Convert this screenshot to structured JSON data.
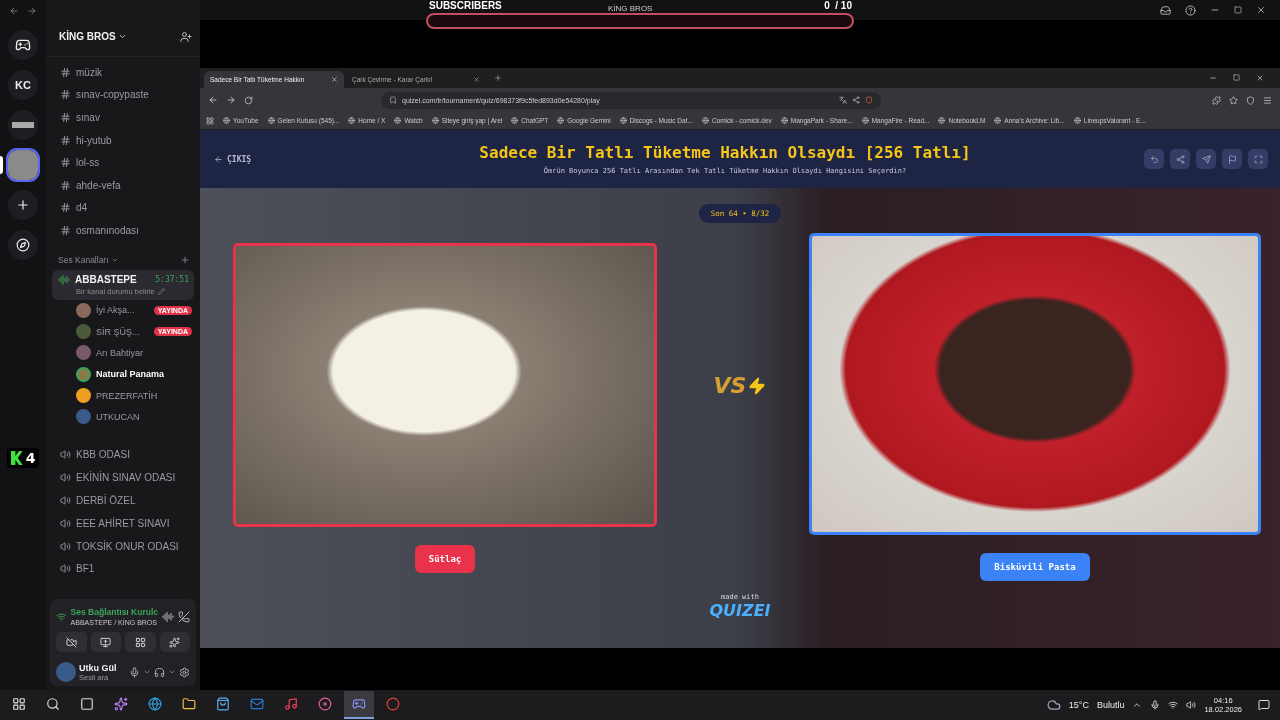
{
  "overlay": {
    "label": "SUBSCRIBERS",
    "server": "KİNG BROS",
    "count": "0",
    "goal": "/ 10",
    "level": 0
  },
  "servers": [
    {
      "kind": "logo"
    },
    {
      "kind": "initials",
      "label": "KC"
    },
    {
      "kind": "banner"
    },
    {
      "kind": "avatar",
      "selected": true
    },
    {
      "kind": "add"
    },
    {
      "kind": "explore"
    }
  ],
  "stream_badge": {
    "count": "4"
  },
  "server_name": "KİNG BROS",
  "text_channels": [
    "müzik",
    "sınav-copypaste",
    "sınav",
    "hi-yutub",
    "lol-ss",
    "ahde-vefa",
    "d4",
    "osmanınodası"
  ],
  "voice_header": "Ses Kanalları",
  "active_voice": {
    "name": "ABBASTEPE",
    "timer": "5:37:51",
    "status": "Bir kanal durumu belirle",
    "members": [
      {
        "name": "İyi Akşa...",
        "badge": "YAYINDA",
        "speaking": false,
        "color": "#8a6a5a"
      },
      {
        "name": "SİR ŞÜŞ...",
        "badge": "YAYINDA",
        "speaking": false,
        "color": "#4a5a3a"
      },
      {
        "name": "Arı Bahtiyar",
        "speaking": false,
        "color": "#7a5a6a"
      },
      {
        "name": "Natural Panama",
        "speaking": true,
        "color": "#8a7a4a"
      },
      {
        "name": "PREZERFATİH",
        "speaking": false,
        "color": "#f0a020"
      },
      {
        "name": "UTKUCAN",
        "speaking": false,
        "color": "#3a5a8a"
      }
    ]
  },
  "voice_channels": [
    "KBB ODASI",
    "EKİNİN SINAV ODASI",
    "DERBİ ÖZEL",
    "EEE AHİRET SINAVI",
    "TOKSİK ONUR ODASI",
    "BF1"
  ],
  "voice_connection": {
    "status": "Ses Bağlantısı Kurulc",
    "channel": "ABBASTEPE / KİNG BROS"
  },
  "user": {
    "name": "Utku Gül",
    "status": "Sesli ara"
  },
  "browser": {
    "tabs": [
      {
        "title": "Sadece Bir Tatlı Tüketme Hakkın",
        "selected": true
      },
      {
        "title": "Çark Çevirme - Karar Çarkı!",
        "selected": false
      }
    ],
    "url": "quizei.com/tr/tournament/quiz/698373f9c5fed893d0e54280/play",
    "bookmarks": [
      "YouTube",
      "Gelen Kutusu (545)...",
      "Home / X",
      "Watch",
      "Siteye giriş yap | Arel",
      "ChatGPT",
      "Google Gemini",
      "Discogs - Music Dat...",
      "Comick - comick.dev",
      "MangaPark - Share...",
      "MangaFire - Read...",
      "NotebookLM",
      "Anna's Archive: Lib...",
      "LineupsValorant - E..."
    ]
  },
  "quiz": {
    "back": "ÇIKIŞ",
    "title": "Sadece Bir Tatlı Tüketme Hakkın Olsaydı [256 Tatlı]",
    "subtitle": "Ömrün Boyunca 256 Tatlı Arasından Tek Tatlı Tüketme Hakkın Olsaydı Hangisini Seçerdin?",
    "round": "Son 64 • 8/32",
    "vs": "VS",
    "made_with": "made with",
    "brand": "QUIZEI",
    "options": [
      {
        "label": "Sütlaç",
        "color": "#e8334a"
      },
      {
        "label": "Bisküvili Pasta",
        "color": "#3b82f6"
      }
    ]
  },
  "taskbar": {
    "temperature": "15°C",
    "weather": "Bulutlu",
    "time": "04:16",
    "date": "18.02.2026"
  }
}
